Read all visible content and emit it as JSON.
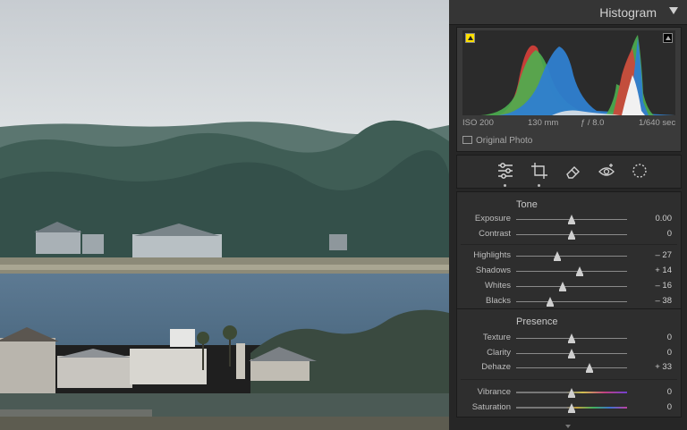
{
  "histogram": {
    "title": "Histogram",
    "iso": "ISO 200",
    "focal": "130 mm",
    "aperture": "ƒ / 8.0",
    "shutter": "1/640 sec",
    "original_photo_label": "Original Photo"
  },
  "toolbar": {
    "tools": [
      {
        "icon": "sliders-icon",
        "active": true
      },
      {
        "icon": "crop-icon",
        "active": false
      },
      {
        "icon": "eraser-icon",
        "active": false
      },
      {
        "icon": "red-eye-icon",
        "active": false
      },
      {
        "icon": "masking-icon",
        "active": false
      }
    ]
  },
  "tone": {
    "title": "Tone",
    "sliders": [
      {
        "label": "Exposure",
        "value": "0.00",
        "pos": 0.5
      },
      {
        "label": "Contrast",
        "value": "0",
        "pos": 0.5
      },
      {
        "label": "Highlights",
        "value": "– 27",
        "pos": 0.37
      },
      {
        "label": "Shadows",
        "value": "+ 14",
        "pos": 0.57
      },
      {
        "label": "Whites",
        "value": "– 16",
        "pos": 0.42
      },
      {
        "label": "Blacks",
        "value": "– 38",
        "pos": 0.31
      }
    ]
  },
  "presence": {
    "title": "Presence",
    "sliders": [
      {
        "label": "Texture",
        "value": "0",
        "pos": 0.5
      },
      {
        "label": "Clarity",
        "value": "0",
        "pos": 0.5
      },
      {
        "label": "Dehaze",
        "value": "+ 33",
        "pos": 0.66
      }
    ],
    "color_sliders": [
      {
        "label": "Vibrance",
        "value": "0",
        "pos": 0.5
      },
      {
        "label": "Saturation",
        "value": "0",
        "pos": 0.5
      }
    ]
  },
  "colors": {
    "panel_bg": "#262626",
    "histogram_red": "#d8403a",
    "histogram_green": "#4caf50",
    "histogram_blue": "#2f7fd0"
  }
}
